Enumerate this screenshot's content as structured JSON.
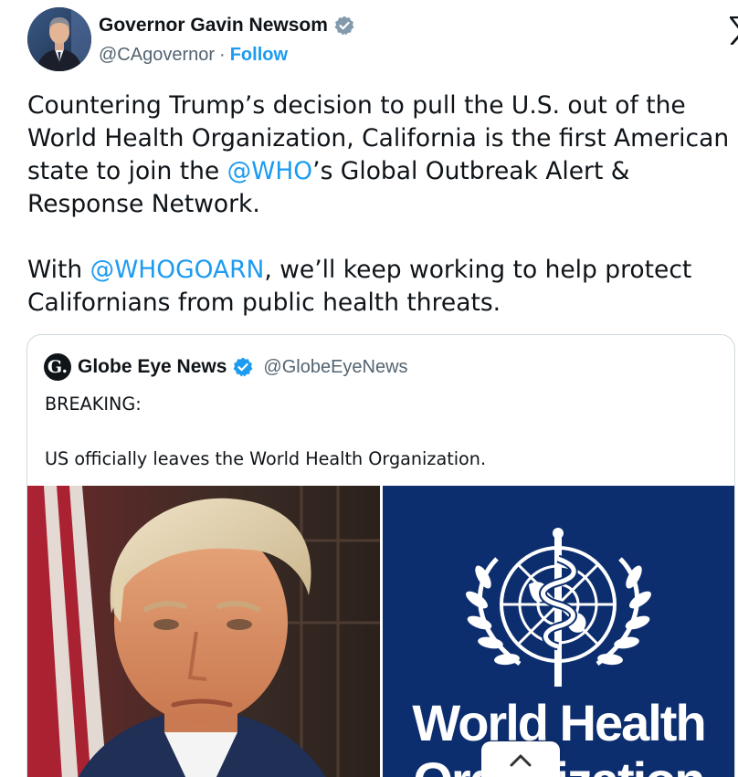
{
  "author": {
    "display_name": "Governor Gavin Newsom",
    "handle": "@CAgovernor",
    "separator": "·",
    "follow_label": "Follow",
    "verified_badge": "gray-verified-check-icon",
    "avatar": "avatar-photo"
  },
  "platform": {
    "logo": "x-logo-icon"
  },
  "tweet": {
    "lines": [
      "Countering Trump’s decision to pull the U.S. out of the",
      "World Health Organization, California is the first American",
      "state to join the ",
      "@WHO",
      "’s Global Outbreak Alert &",
      "Response Network.",
      "With ",
      "@WHOGOARN",
      ", we’ll keep working to help protect",
      "Californians from public health threats."
    ]
  },
  "quote": {
    "logo_letter": "G.",
    "display_name": "Globe Eye News",
    "handle": "@GlobeEyeNews",
    "verified_badge": "blue-verified-check-icon",
    "text_line_1": "BREAKING:",
    "text_line_2": "US officially leaves the World Health Organization.",
    "media": {
      "left_image": "portrait-photo",
      "right_image": "who-emblem",
      "right_title": "World Health",
      "right_subtitle_partial": "Organization"
    }
  },
  "controls": {
    "scroll_icon": "chevron-up-icon"
  },
  "colors": {
    "link": "#1d9bf0",
    "text": "#0f1419",
    "muted": "#536471",
    "border": "#cfd9de",
    "who_blue": "#0d2e6e",
    "verified_blue": "#1d9bf0",
    "verified_gray": "#829aab"
  }
}
